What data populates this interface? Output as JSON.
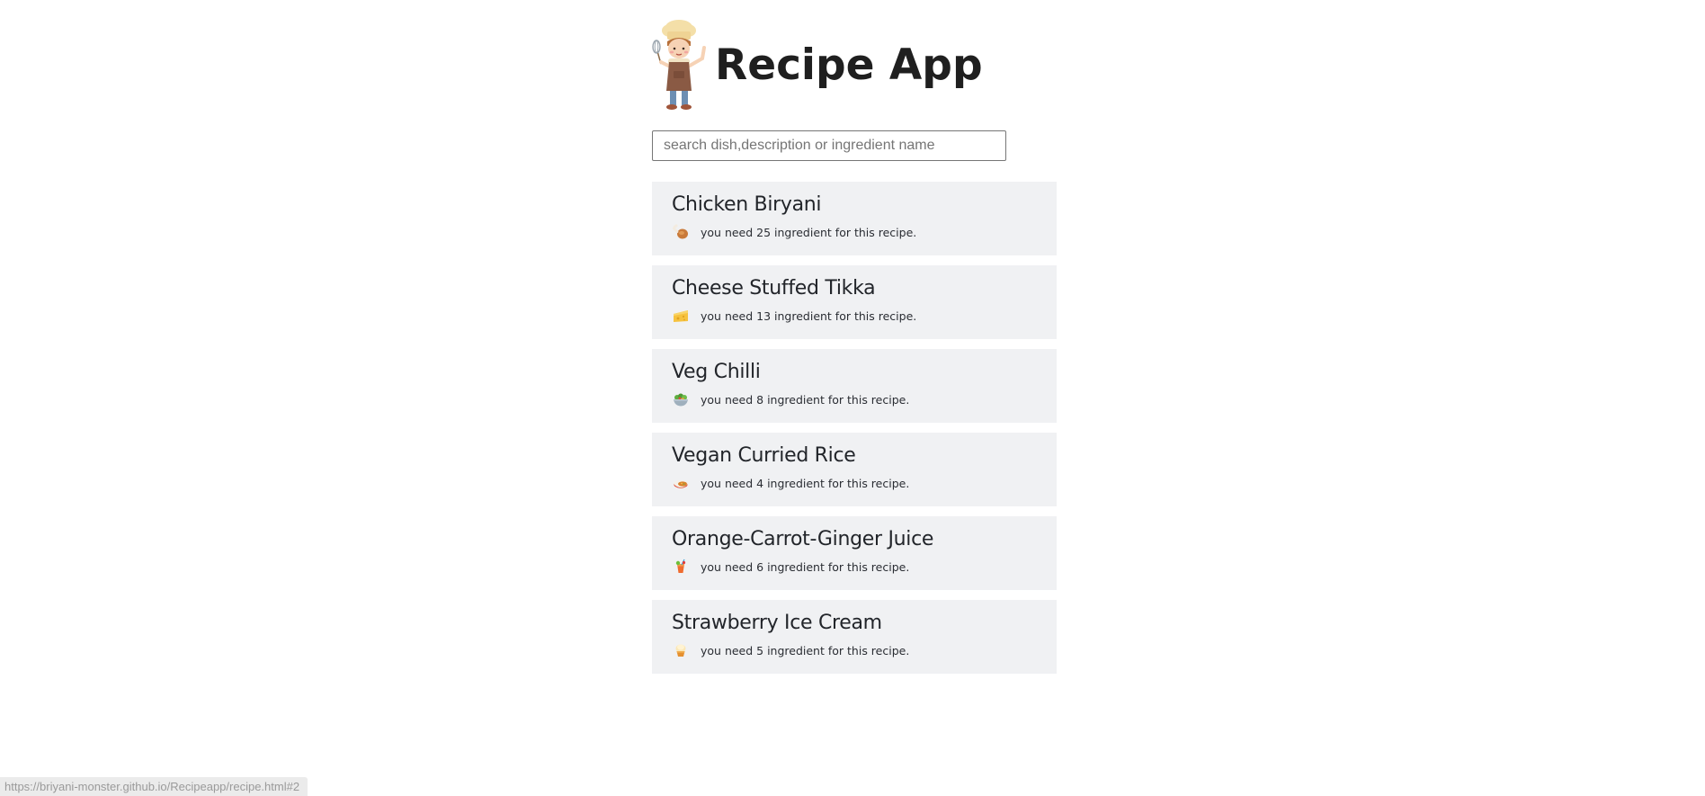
{
  "header": {
    "title": "Recipe App",
    "logo_icon": "chef-icon"
  },
  "search": {
    "placeholder": "search dish,description or ingredient name",
    "value": ""
  },
  "recipes": [
    {
      "name": "Chicken Biryani",
      "ingredients_text": "you need 25 ingredient for this recipe.",
      "icon": "chicken-leg-icon"
    },
    {
      "name": "Cheese Stuffed Tikka",
      "ingredients_text": "you need 13 ingredient for this recipe.",
      "icon": "cheese-icon"
    },
    {
      "name": "Veg Chilli",
      "ingredients_text": "you need 8 ingredient for this recipe.",
      "icon": "salad-bowl-icon"
    },
    {
      "name": "Vegan Curried Rice",
      "ingredients_text": "you need 4 ingredient for this recipe.",
      "icon": "curry-rice-icon"
    },
    {
      "name": "Orange-Carrot-Ginger Juice",
      "ingredients_text": "you need 6 ingredient for this recipe.",
      "icon": "tropical-drink-icon"
    },
    {
      "name": "Strawberry Ice Cream",
      "ingredients_text": "you need 5 ingredient for this recipe.",
      "icon": "ice-cream-icon"
    }
  ],
  "status_bar": {
    "url": "https://briyani-monster.github.io/Recipeapp/recipe.html#2"
  },
  "colors": {
    "card_background": "#f0f1f3",
    "title_text": "#1f1f1f",
    "body_text": "#22252a"
  }
}
